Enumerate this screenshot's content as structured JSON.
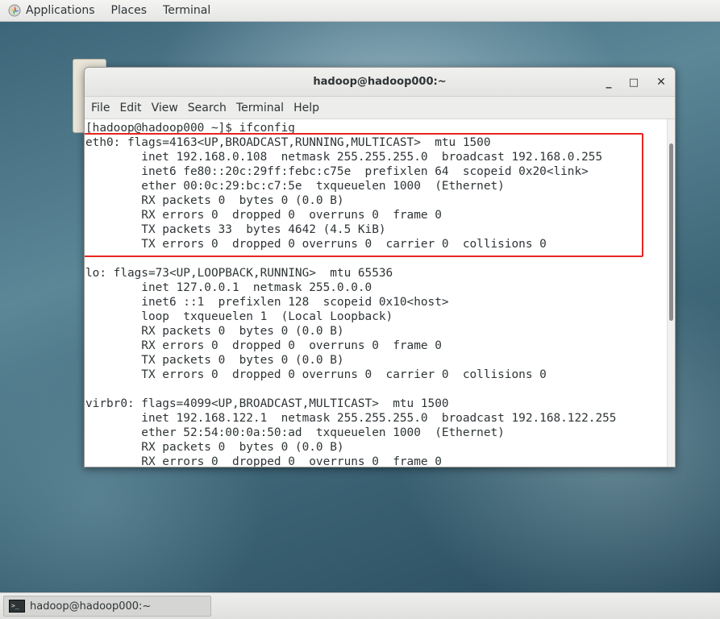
{
  "topbar": {
    "applications": "Applications",
    "places": "Places",
    "terminal": "Terminal"
  },
  "window": {
    "title": "hadoop@hadoop000:~",
    "minimize": "_",
    "maximize": "□",
    "close": "✕",
    "menu": [
      "File",
      "Edit",
      "View",
      "Search",
      "Terminal",
      "Help"
    ]
  },
  "terminal": {
    "lines": [
      "[hadoop@hadoop000 ~]$ ifconfig",
      "eth0: flags=4163<UP,BROADCAST,RUNNING,MULTICAST>  mtu 1500",
      "        inet 192.168.0.108  netmask 255.255.255.0  broadcast 192.168.0.255",
      "        inet6 fe80::20c:29ff:febc:c75e  prefixlen 64  scopeid 0x20<link>",
      "        ether 00:0c:29:bc:c7:5e  txqueuelen 1000  (Ethernet)",
      "        RX packets 0  bytes 0 (0.0 B)",
      "        RX errors 0  dropped 0  overruns 0  frame 0",
      "        TX packets 33  bytes 4642 (4.5 KiB)",
      "        TX errors 0  dropped 0 overruns 0  carrier 0  collisions 0",
      "",
      "lo: flags=73<UP,LOOPBACK,RUNNING>  mtu 65536",
      "        inet 127.0.0.1  netmask 255.0.0.0",
      "        inet6 ::1  prefixlen 128  scopeid 0x10<host>",
      "        loop  txqueuelen 1  (Local Loopback)",
      "        RX packets 0  bytes 0 (0.0 B)",
      "        RX errors 0  dropped 0  overruns 0  frame 0",
      "        TX packets 0  bytes 0 (0.0 B)",
      "        TX errors 0  dropped 0 overruns 0  carrier 0  collisions 0",
      "",
      "virbr0: flags=4099<UP,BROADCAST,MULTICAST>  mtu 1500",
      "        inet 192.168.122.1  netmask 255.255.255.0  broadcast 192.168.122.255",
      "        ether 52:54:00:0a:50:ad  txqueuelen 1000  (Ethernet)",
      "        RX packets 0  bytes 0 (0.0 B)",
      "        RX errors 0  dropped 0  overruns 0  frame 0"
    ],
    "highlight_color": "#e8251f"
  },
  "taskbar": {
    "item_label": "hadoop@hadoop000:~",
    "item_icon": "terminal-icon"
  }
}
